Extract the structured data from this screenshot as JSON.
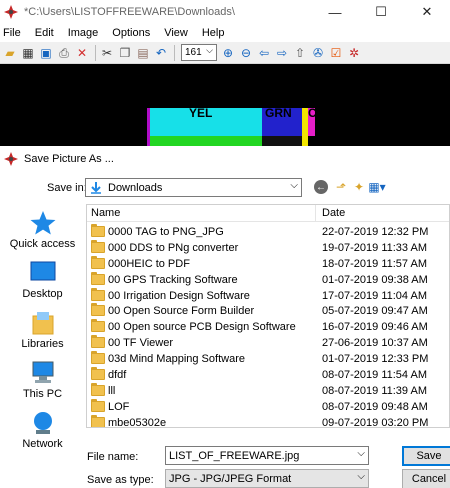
{
  "window": {
    "title": "*C:\\Users\\LISTOFFREEWARE\\Downloads\\",
    "min": "—",
    "max": "☐",
    "close": "✕"
  },
  "menu": [
    "File",
    "Edit",
    "Image",
    "Options",
    "View",
    "Help"
  ],
  "toolbar": {
    "zoom_value": "161"
  },
  "image_preview": {
    "labels": [
      "YEL",
      "GRN",
      "C"
    ]
  },
  "dialog": {
    "title": "Save Picture As ...",
    "save_in_label": "Save in:",
    "save_in_value": "Downloads",
    "places": [
      "Quick access",
      "Desktop",
      "Libraries",
      "This PC",
      "Network"
    ],
    "columns": {
      "name": "Name",
      "date": "Date"
    },
    "files": [
      {
        "name": "0000 TAG to PNG_JPG",
        "date": "22-07-2019 12:32 PM"
      },
      {
        "name": "000 DDS  to PNg converter",
        "date": "19-07-2019 11:33 AM"
      },
      {
        "name": "000HEIC to PDF",
        "date": "18-07-2019 11:57 AM"
      },
      {
        "name": "00 GPS Tracking Software",
        "date": "01-07-2019 09:38 AM"
      },
      {
        "name": "00 Irrigation Design Software",
        "date": "17-07-2019 11:04 AM"
      },
      {
        "name": "00 Open Source Form Builder",
        "date": "05-07-2019 09:47 AM"
      },
      {
        "name": "00 Open source PCB Design Software",
        "date": "16-07-2019 09:46 AM"
      },
      {
        "name": "00 TF Viewer",
        "date": "27-06-2019 10:37 AM"
      },
      {
        "name": "03d Mind Mapping Software",
        "date": "01-07-2019 12:33 PM"
      },
      {
        "name": "dfdf",
        "date": "08-07-2019 11:54 AM"
      },
      {
        "name": "lll",
        "date": "08-07-2019 11:39 AM"
      },
      {
        "name": "LOF",
        "date": "08-07-2019 09:48 AM"
      },
      {
        "name": "mbe05302e",
        "date": "09-07-2019 03:20 PM"
      }
    ],
    "file_name_label": "File name:",
    "file_name_value": "LIST_OF_FREEWARE.jpg",
    "save_as_type_label": "Save as type:",
    "save_as_type_value": "JPG - JPG/JPEG Format",
    "save_button": "Save",
    "cancel_button": "Cancel"
  },
  "colors": {
    "accent": "#0078d7",
    "folder": "#f1c14e",
    "quick_access_star": "#1e88e5"
  },
  "icons": [
    "irfanview-app-icon",
    "open-icon",
    "slideshow-icon",
    "save-icon",
    "print-icon",
    "delete-icon",
    "cut-icon",
    "copy-icon",
    "paste-icon",
    "undo-icon",
    "zoom-in-icon",
    "zoom-out-icon",
    "prev-icon",
    "next-icon",
    "fit-icon",
    "exif-icon",
    "settings-icon",
    "back-icon",
    "up-folder-icon",
    "new-folder-icon",
    "view-menu-icon"
  ]
}
